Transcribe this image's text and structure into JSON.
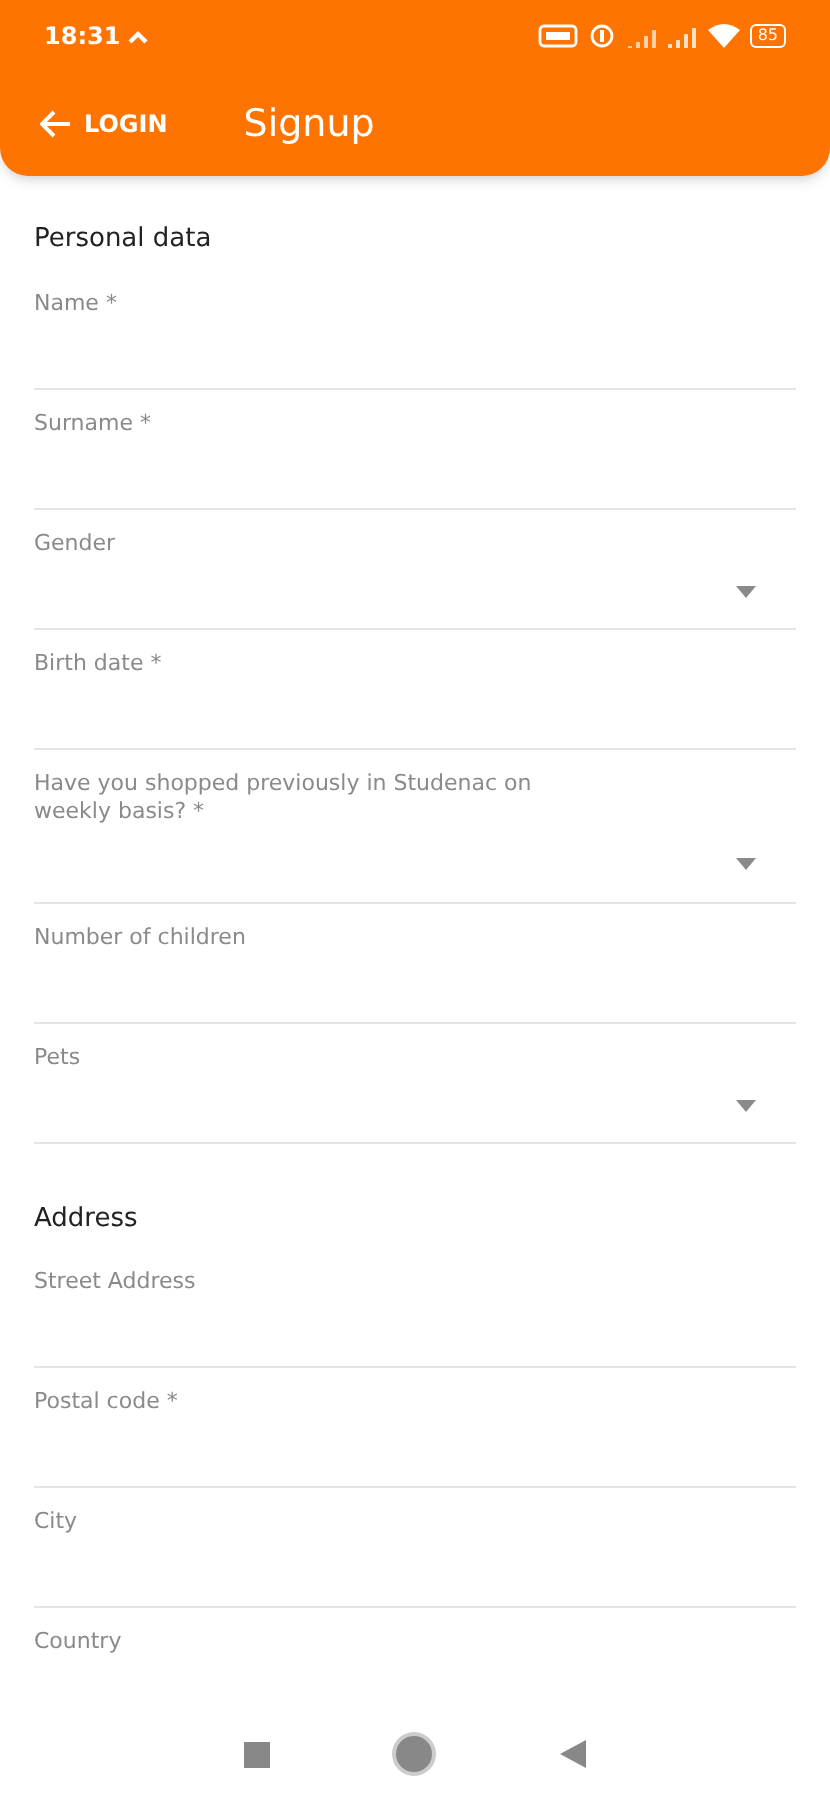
{
  "status_bar": {
    "time": "18:31",
    "battery": "85"
  },
  "app_bar": {
    "back_label": "LOGIN",
    "title": "Signup"
  },
  "sections": [
    {
      "title": "Personal data",
      "fields": [
        {
          "label": "Name *",
          "kind": "text"
        },
        {
          "label": "Surname *",
          "kind": "text"
        },
        {
          "label": "Gender",
          "kind": "dropdown"
        },
        {
          "label": "Birth date *",
          "kind": "text"
        },
        {
          "label": "Have you shopped previously in Studenac on weekly basis? *",
          "kind": "dropdown"
        },
        {
          "label": "Number of children",
          "kind": "text"
        },
        {
          "label": "Pets",
          "kind": "dropdown"
        }
      ]
    },
    {
      "title": "Address",
      "fields": [
        {
          "label": "Street Address",
          "kind": "text"
        },
        {
          "label": "Postal code *",
          "kind": "text"
        },
        {
          "label": "City",
          "kind": "text"
        },
        {
          "label": "Country",
          "kind": "text"
        }
      ]
    }
  ]
}
